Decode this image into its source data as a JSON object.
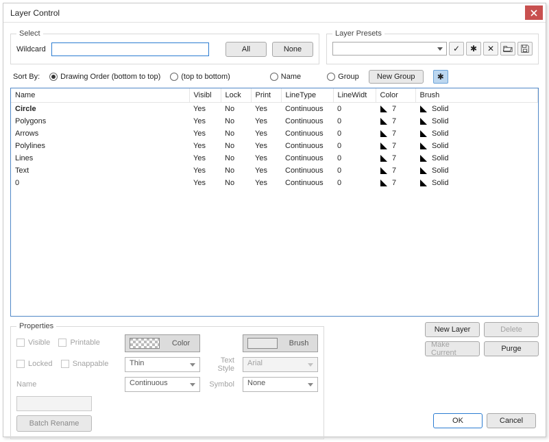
{
  "window": {
    "title": "Layer Control"
  },
  "select_group": {
    "legend": "Select",
    "wildcard_label": "Wildcard",
    "wildcard_value": "",
    "all_btn": "All",
    "none_btn": "None"
  },
  "presets_group": {
    "legend": "Layer Presets",
    "selected": ""
  },
  "sort": {
    "label": "Sort By:",
    "options": {
      "drawing_order_bt": "Drawing Order (bottom to top)",
      "drawing_order_tb": "(top to bottom)",
      "name": "Name",
      "group": "Group"
    },
    "selected": "drawing_order_bt",
    "new_group_btn": "New Group"
  },
  "table": {
    "headers": {
      "name": "Name",
      "visible": "Visibl",
      "lock": "Lock",
      "print": "Print",
      "linetype": "LineType",
      "linewidth": "LineWidt",
      "color": "Color",
      "brush": "Brush"
    },
    "rows": [
      {
        "name": "Circle",
        "bold": true,
        "visible": "Yes",
        "lock": "No",
        "print": "Yes",
        "linetype": "Continuous",
        "linewidth": "0",
        "color": "7",
        "brush": "Solid"
      },
      {
        "name": "Polygons",
        "bold": false,
        "visible": "Yes",
        "lock": "No",
        "print": "Yes",
        "linetype": "Continuous",
        "linewidth": "0",
        "color": "7",
        "brush": "Solid"
      },
      {
        "name": "Arrows",
        "bold": false,
        "visible": "Yes",
        "lock": "No",
        "print": "Yes",
        "linetype": "Continuous",
        "linewidth": "0",
        "color": "7",
        "brush": "Solid"
      },
      {
        "name": "Polylines",
        "bold": false,
        "visible": "Yes",
        "lock": "No",
        "print": "Yes",
        "linetype": "Continuous",
        "linewidth": "0",
        "color": "7",
        "brush": "Solid"
      },
      {
        "name": "Lines",
        "bold": false,
        "visible": "Yes",
        "lock": "No",
        "print": "Yes",
        "linetype": "Continuous",
        "linewidth": "0",
        "color": "7",
        "brush": "Solid"
      },
      {
        "name": "Text",
        "bold": false,
        "visible": "Yes",
        "lock": "No",
        "print": "Yes",
        "linetype": "Continuous",
        "linewidth": "0",
        "color": "7",
        "brush": "Solid"
      },
      {
        "name": "0",
        "bold": false,
        "visible": "Yes",
        "lock": "No",
        "print": "Yes",
        "linetype": "Continuous",
        "linewidth": "0",
        "color": "7",
        "brush": "Solid"
      }
    ]
  },
  "properties": {
    "legend": "Properties",
    "checks": {
      "visible": "Visible",
      "printable": "Printable",
      "locked": "Locked",
      "snappable": "Snappable"
    },
    "name_label": "Name",
    "name_value": "",
    "color_label": "Color",
    "brush_label": "Brush",
    "thickness_value": "Thin",
    "linetype_value": "Continuous",
    "text_style_label": "Text Style",
    "text_style_value": "Arial",
    "symbol_label": "Symbol",
    "symbol_value": "None",
    "batch_rename": "Batch Rename"
  },
  "buttons": {
    "new_layer": "New Layer",
    "delete": "Delete",
    "make_current": "Make Current",
    "purge": "Purge",
    "ok": "OK",
    "cancel": "Cancel"
  }
}
